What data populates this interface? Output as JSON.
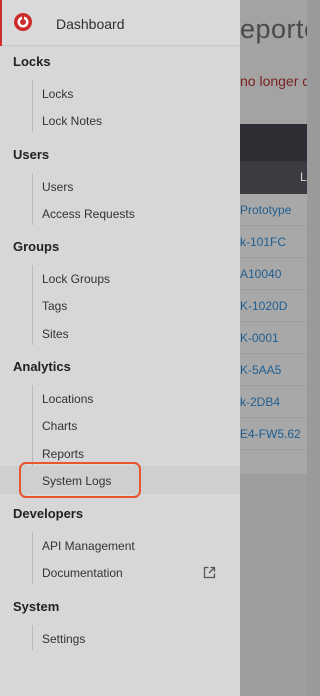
{
  "background": {
    "title_fragment": "eporte",
    "warning_fragment": "no longer co",
    "header_fragment": "L",
    "cells": [
      "Prototype",
      "k-101FC",
      "A10040",
      "K-1020D",
      "K-0001",
      "K-5AA5",
      "k-2DB4",
      "E4-FW5.62"
    ]
  },
  "sidebar": {
    "dashboard_label": "Dashboard",
    "sections": [
      {
        "title": "Locks",
        "items": [
          "Locks",
          "Lock Notes"
        ]
      },
      {
        "title": "Users",
        "items": [
          "Users",
          "Access Requests"
        ]
      },
      {
        "title": "Groups",
        "items": [
          "Lock Groups",
          "Tags",
          "Sites"
        ]
      },
      {
        "title": "Analytics",
        "items": [
          "Locations",
          "Charts",
          "Reports",
          "System Logs"
        ]
      },
      {
        "title": "Developers",
        "items": [
          "API Management",
          "Documentation"
        ]
      },
      {
        "title": "System",
        "items": [
          "Settings"
        ]
      }
    ],
    "highlighted_item": "System Logs",
    "accent_color": "#cc2b2b",
    "highlight_color": "#e8572c",
    "external_link_icon": "external-link-icon"
  }
}
